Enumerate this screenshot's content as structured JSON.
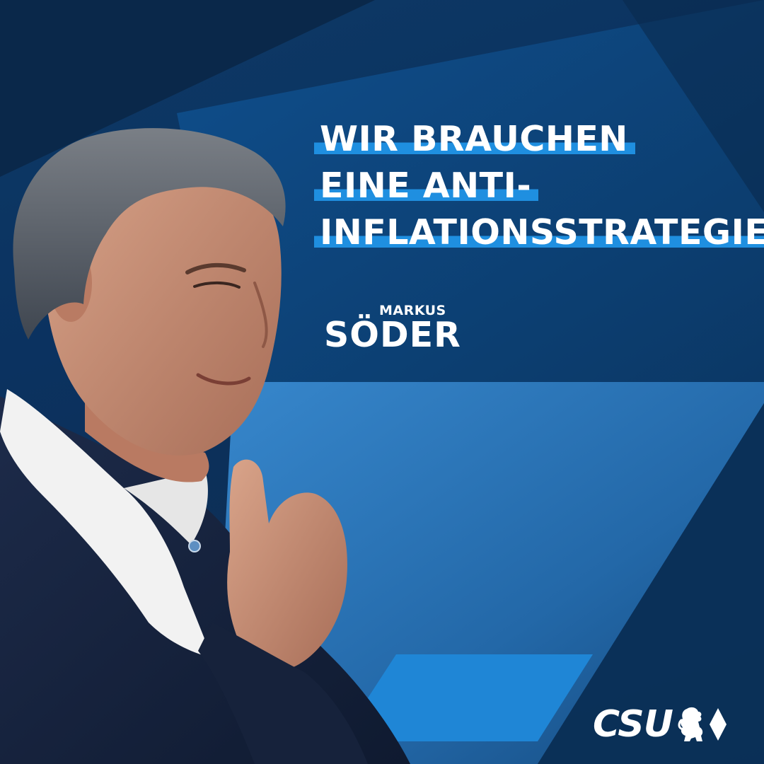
{
  "headline": {
    "lines": [
      "WIR BRAUCHEN",
      "EINE ANTI-",
      "INFLATIONSSTRATEGIE."
    ]
  },
  "signature": {
    "first_name": "MARKUS",
    "last_name": "SÖDER"
  },
  "logo": {
    "text": "CSU",
    "emblem_icons": [
      "lion-icon",
      "diamond-icon"
    ]
  },
  "photo": {
    "subject": "speaker-portrait"
  },
  "colors": {
    "background_dark": "#0b2a4a",
    "background_mid": "#0e4a86",
    "background_light": "#2f7fc4",
    "highlight": "#1f8fe0",
    "text": "#ffffff"
  }
}
